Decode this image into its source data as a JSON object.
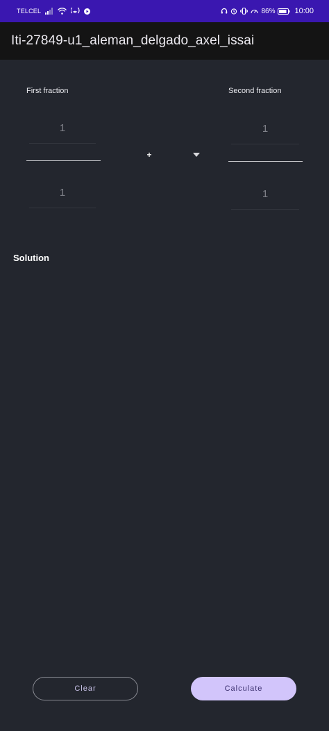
{
  "status_bar": {
    "carrier": "TELCEL",
    "battery": "86%",
    "time": "10:00",
    "icons": [
      "signal-icon",
      "wifi-icon",
      "hotspot-icon",
      "play-icon",
      "headset-icon",
      "alarm-icon",
      "vibrate-icon",
      "speed-icon",
      "battery-icon"
    ]
  },
  "app_bar": {
    "title": "Iti-27849-u1_aleman_delgado_axel_issai"
  },
  "first_fraction": {
    "label": "First fraction",
    "numerator_placeholder": "1",
    "denominator_placeholder": "1"
  },
  "second_fraction": {
    "label": "Second fraction",
    "numerator_placeholder": "1",
    "denominator_placeholder": "1"
  },
  "operator": {
    "selected": "+"
  },
  "solution": {
    "heading": "Solution"
  },
  "buttons": {
    "clear_label": "Clear",
    "calculate_label": "Calculate"
  },
  "colors": {
    "status_bar": "#3a17b0",
    "app_bar": "#141414",
    "background": "#23262e",
    "primary_button": "#d2c5fb"
  }
}
